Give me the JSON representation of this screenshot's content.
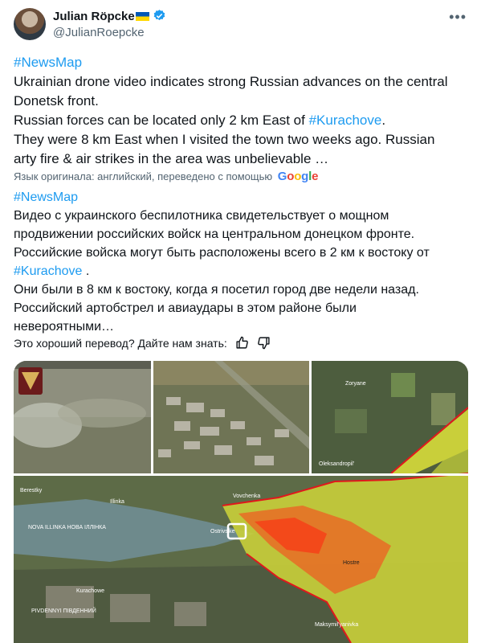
{
  "author": {
    "name": "Julian Röpcke",
    "handle": "@JulianRoepcke"
  },
  "post_en": {
    "hashtag": "#NewsMap",
    "line1": "Ukrainian drone video indicates strong Russian advances on the central",
    "line2": "Donetsk front.",
    "line3_pre": "Russian forces can be located only 2 km East of ",
    "line3_tag": "#Kurachove",
    "line3_post": ".",
    "line4": "They were 8 km East when I visited the town two weeks ago. Russian",
    "line5": "arty fire & air strikes in the area was unbelievable …"
  },
  "translation_note": {
    "text": "Язык оригинала: английский, переведено с помощью",
    "brand": [
      "G",
      "o",
      "o",
      "g",
      "l",
      "e"
    ]
  },
  "post_ru": {
    "hashtag": "#NewsMap",
    "line1": "Видео с украинского беспилотника свидетельствует о мощном",
    "line2": "продвижении российских войск на центральном донецком фронте.",
    "line3": "Российские войска могут быть расположены всего в 2 км к востоку от",
    "line4_tag": "#Kurachove",
    "line4_post": " .",
    "line5": "Они были в 8 км к востоку, когда я посетил город две недели назад.",
    "line6": "Российский артобстрел и авиаудары в этом районе были",
    "line7": "невероятными…"
  },
  "feedback": {
    "question": "Это хороший перевод? Дайте нам знать:"
  },
  "media": {
    "map_labels": {
      "zoryane": "Zoryane",
      "oleksandropil": "Oleksandropil'",
      "berestky": "Berestky",
      "illinka": "Illinka",
      "vovchenka": "Vovchenka",
      "nova_illinka": "NOVA ILLINKA НОВА ІЛЛІНКА",
      "ostrivske": "Ostrivs'ke",
      "kurachowe": "Kurachowe",
      "hostre": "Hostre",
      "pivdennyi": "PIVDENNYI ПІВДЕННИЙ",
      "maksymilianivka": "Maksymil'yanivka"
    },
    "colors": {
      "russian_control": "#c9cf3a",
      "activity": "#ff3a1a",
      "frontline": "#e0181c"
    }
  },
  "icons": {
    "verified": "verified-badge-icon",
    "more": "more-options-icon",
    "thumbs_up": "thumbs-up-icon",
    "thumbs_down": "thumbs-down-icon"
  }
}
